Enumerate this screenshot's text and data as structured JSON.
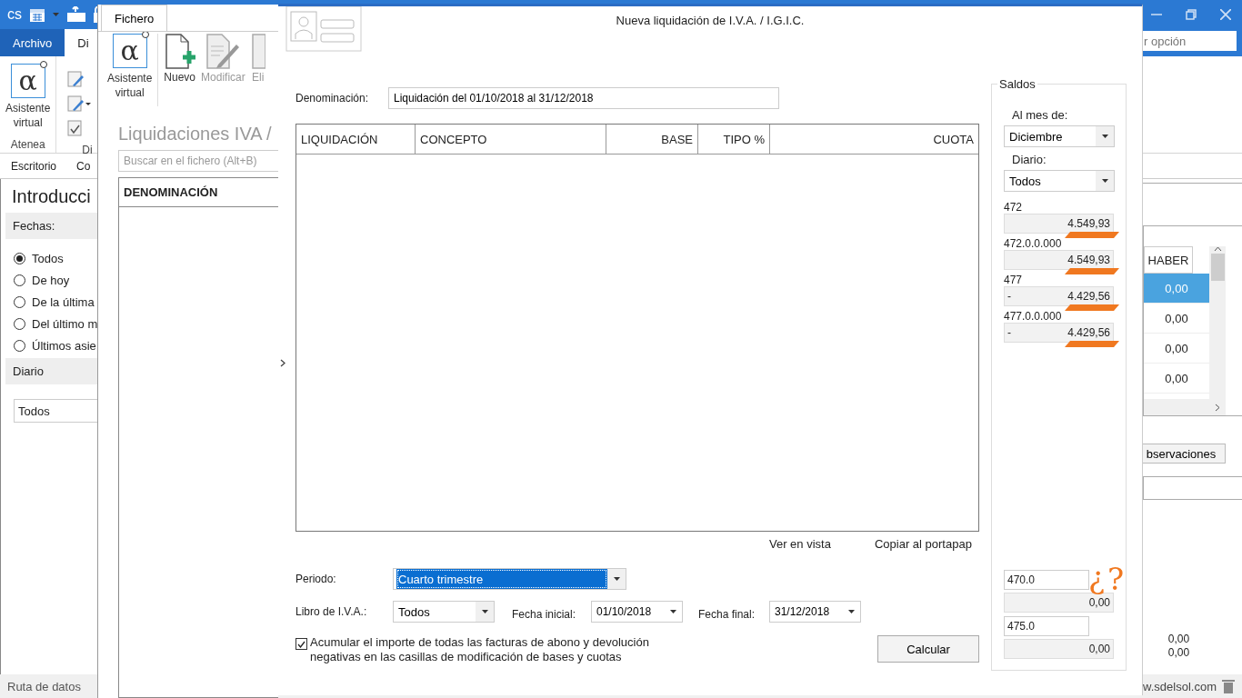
{
  "app": {
    "logo": "cs",
    "tabs": [
      {
        "label": "Archivo",
        "kind": "file",
        "selected": false
      },
      {
        "label": "Di",
        "kind": "tab",
        "selected": true
      }
    ],
    "search": {
      "placeholder": "r opción"
    },
    "ribbon": {
      "assistant": {
        "glyph": "α",
        "label": "Asistente virtual"
      },
      "groups": [
        "Atenea",
        "Di"
      ]
    },
    "nav": [
      "Escritorio",
      "Co"
    ],
    "panel": {
      "title": "Introducci",
      "fechas_label": "Fechas:",
      "date_options": [
        {
          "label": "Todos",
          "selected": true
        },
        {
          "label": "De hoy",
          "selected": false
        },
        {
          "label": "De la última",
          "selected": false
        },
        {
          "label": "Del último m",
          "selected": false
        },
        {
          "label": "Últimos asie",
          "selected": false
        }
      ],
      "diario_label": "Diario",
      "diario_value": "Todos"
    },
    "grid": {
      "column": "HABER",
      "rows": [
        {
          "haber": "0,00",
          "selected": true
        },
        {
          "haber": "0,00",
          "selected": false
        },
        {
          "haber": "0,00",
          "selected": false
        },
        {
          "haber": "0,00",
          "selected": false
        }
      ],
      "button": "bservaciones",
      "totals": [
        "0,00",
        "0,00"
      ]
    },
    "status_bar": {
      "left": "Ruta de datos",
      "right": "w.sdelsol.com"
    }
  },
  "fichero": {
    "tab": "Fichero",
    "buttons": [
      {
        "kind": "assistant",
        "glyph": "α",
        "label": "Asistente virtual",
        "disabled": false
      },
      {
        "kind": "new",
        "label": "Nuevo",
        "disabled": false
      },
      {
        "kind": "edit",
        "label": "Modificar",
        "disabled": true
      },
      {
        "kind": "delete",
        "label": "Eli",
        "disabled": true
      }
    ],
    "title": "Liquidaciones IVA /",
    "search": {
      "placeholder": "Buscar en el fichero (Alt+B)"
    },
    "column": "DENOMINACIÓN"
  },
  "dialog": {
    "title": "Nueva liquidación de I.V.A. / I.G.I.C.",
    "denominacion_label": "Denominación:",
    "denominacion": "Liquidación del 01/10/2018 al 31/12/2018",
    "columns": [
      "LIQUIDACIÓN",
      "CONCEPTO",
      "BASE",
      "TIPO %",
      "CUOTA"
    ],
    "links": [
      "Ver en vista",
      "Copiar al portapap"
    ],
    "periodo_label": "Periodo:",
    "periodo": {
      "value": "Cuarto trimestre",
      "selected": true
    },
    "libro_label": "Libro de I.V.A.:",
    "libro": "Todos",
    "fecha_inicial_label": "Fecha inicial:",
    "fecha_inicial": "01/10/2018",
    "fecha_final_label": "Fecha final:",
    "fecha_final": "31/12/2018",
    "acumular": {
      "label": "Acumular el importe de todas las facturas de abono y devolución negativas en las casillas de modificación de bases y cuotas",
      "checked": true
    },
    "calcular": "Calcular",
    "saldos": {
      "title": "Saldos",
      "mes_label": "Al mes de:",
      "mes": "Diciembre",
      "diario_label": "Diario:",
      "diario": "Todos",
      "accounts": [
        {
          "account": "472",
          "amount": "4.549,93",
          "marked": true
        },
        {
          "account": "472.0.0.000",
          "amount": "4.549,93",
          "marked": true
        },
        {
          "account": "477",
          "sign": "-",
          "amount": "4.429,56",
          "marked": true
        },
        {
          "account": "477.0.0.000",
          "sign": "-",
          "amount": "4.429,56",
          "marked": true
        }
      ],
      "bottom": [
        {
          "account": "470.0",
          "amount": "0,00"
        },
        {
          "account": "475.0",
          "amount": "0,00"
        }
      ],
      "annotations": [
        "¿",
        "?"
      ]
    }
  }
}
